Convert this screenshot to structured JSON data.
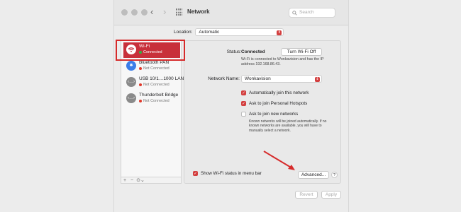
{
  "window": {
    "title": "Network",
    "search_placeholder": "Search"
  },
  "location": {
    "label": "Location:",
    "value": "Automatic"
  },
  "sidebar": {
    "items": [
      {
        "name": "Wi-Fi",
        "status": "Connected",
        "status_color": "#2fb344",
        "icon": "wifi-icon",
        "selected": true
      },
      {
        "name": "Bluetooth PAN",
        "status": "Not Connected",
        "status_color": "#e0392b",
        "icon": "bluetooth-icon"
      },
      {
        "name": "USB 10/1…1000 LAN",
        "status": "Not Connected",
        "status_color": "#e0392b",
        "icon": "ethernet-icon"
      },
      {
        "name": "Thunderbolt Bridge",
        "status": "Not Connected",
        "status_color": "#e0392b",
        "icon": "ethernet-icon"
      }
    ],
    "footer": {
      "add": "+",
      "remove": "−",
      "action": "⊙⌄"
    }
  },
  "detail": {
    "status_label": "Status:",
    "status_value": "Connected",
    "turn_off_label": "Turn Wi-Fi Off",
    "description": "Wi-Fi is connected to Wonkavision and has the IP address 192.168.86.43.",
    "network_name_label": "Network Name:",
    "network_name_value": "Wonkavision",
    "checkboxes": [
      {
        "label": "Automatically join this network",
        "checked": true
      },
      {
        "label": "Ask to join Personal Hotspots",
        "checked": true
      },
      {
        "label": "Ask to join new networks",
        "checked": false
      }
    ],
    "note": "Known networks will be joined automatically. If no known networks are available, you will have to manually select a network.",
    "show_wifi_label": "Show Wi-Fi status in menu bar",
    "show_wifi_checked": true,
    "advanced_label": "Advanced...",
    "help_label": "?"
  },
  "footer": {
    "revert_label": "Revert",
    "apply_label": "Apply"
  },
  "colors": {
    "accent": "#d33f3f",
    "annotation": "#d62b2b"
  }
}
